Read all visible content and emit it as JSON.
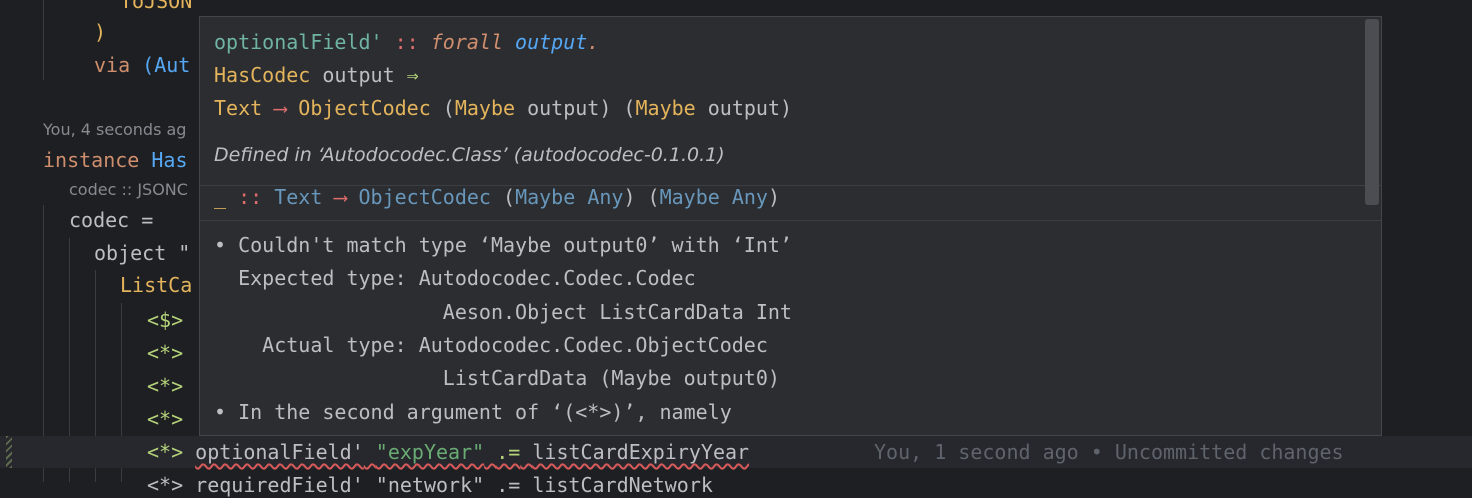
{
  "editor": {
    "lines": {
      "tojson": "ToJSON",
      "paren_close": ")",
      "via_kw": "via",
      "via_rest": "(Aut",
      "blame_hint": "You, 4 seconds ag",
      "instance_kw": "instance",
      "instance_cls": "Has",
      "type_hint": "codec :: JSONC",
      "codec_def": "codec =",
      "object_line": "object \"",
      "listca": "ListCa",
      "op1": "<$>",
      "op2": "<*>",
      "op3": "<*>",
      "op4": "<*>",
      "op5": "<*>",
      "current_fn": "optionalField'",
      "current_str": "\"expYear\"",
      "current_op": ".=",
      "current_rest": "listCardExpiryYear",
      "next_line": "<*> requiredField' \"network\" .= listCardNetwork"
    },
    "current_blame": "You, 1 second ago • Uncommitted changes"
  },
  "popup": {
    "sig_name": "optionalField'",
    "sig_sep": " :: ",
    "sig_forall": "forall",
    "sig_var": "output",
    "sig_dot": ".",
    "constraint_class": "HasCodec",
    "constraint_var": " output ",
    "constraint_arrow": "⇒",
    "t_text": "Text",
    "t_arrow": " ⟶ ",
    "t_objcodec": "ObjectCodec",
    "t_lp1": " (",
    "t_maybe1": "Maybe",
    "t_out1": " output) (",
    "t_maybe2": "Maybe",
    "t_out2": " output)",
    "defined": "Defined in ‘Autodocodec.Class’ (autodocodec-0.1.0.1)",
    "hole": "_",
    "hole_sep": " :: ",
    "hole_text": "Text",
    "hole_arrow": " ⟶ ",
    "hole_obj": "ObjectCodec",
    "hole_p1": " (",
    "hole_maybe1": "Maybe",
    "hole_any1": " Any",
    "hole_p2": ") (",
    "hole_maybe2": "Maybe",
    "hole_any2": " Any",
    "hole_p3": ")",
    "error_lines": [
      "• Couldn't match type ‘Maybe output0’ with ‘Int’",
      "  Expected type: Autodocodec.Codec.Codec",
      "                   Aeson.Object ListCardData Int",
      "    Actual type: Autodocodec.Codec.ObjectCodec",
      "                   ListCardData (Maybe output0)",
      "• In the second argument of ‘(<*>)’, namely"
    ]
  }
}
